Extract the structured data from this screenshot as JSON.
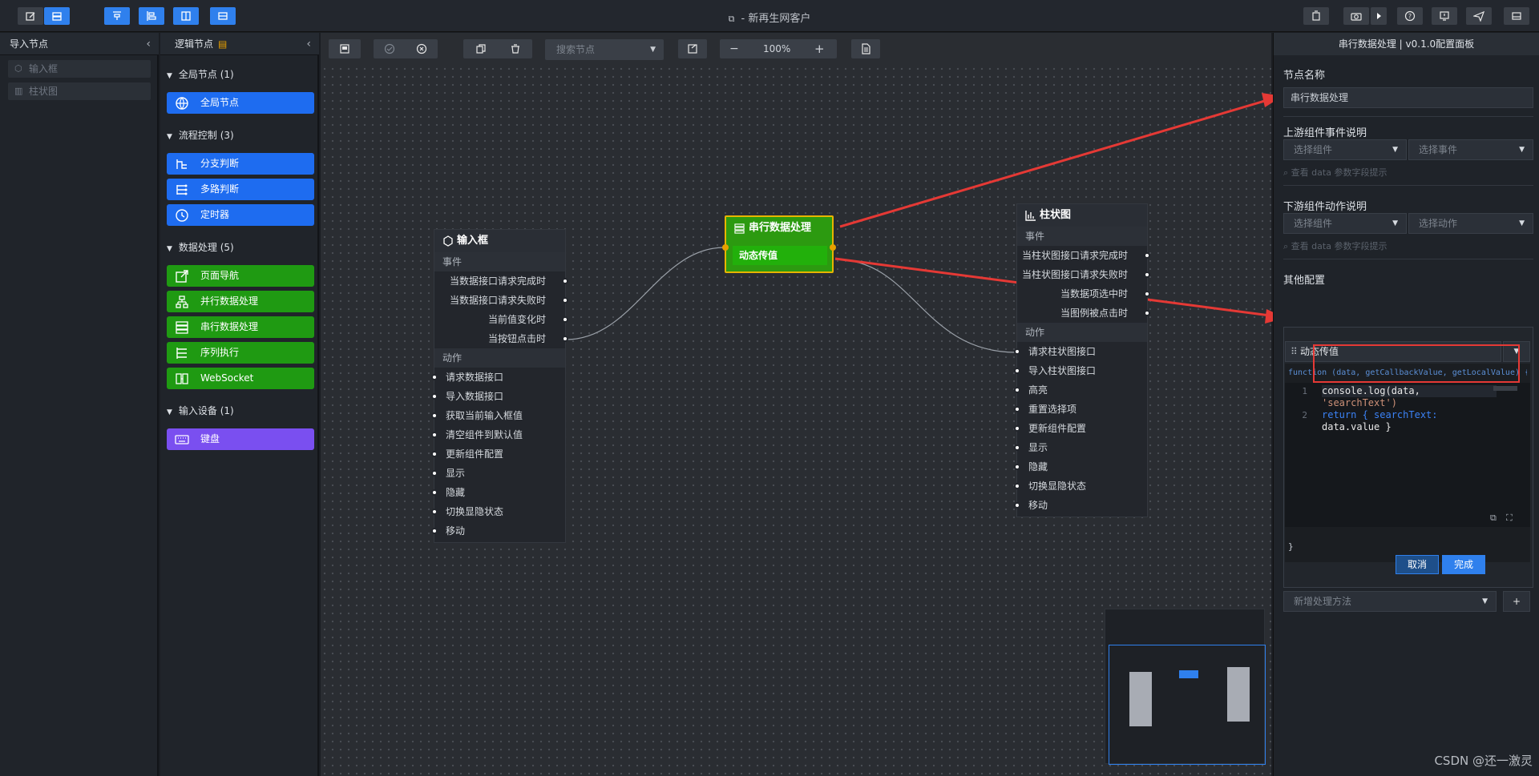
{
  "window": {
    "title": "- 新再生网客户"
  },
  "import_panel": {
    "title": "导入节点",
    "items": [
      {
        "label": "输入框",
        "icon": "input-icon"
      },
      {
        "label": "柱状图",
        "icon": "bar-chart-icon"
      }
    ]
  },
  "logic_panel": {
    "title": "逻辑节点",
    "groups": [
      {
        "title": "全局节点 (1)",
        "items": [
          {
            "label": "全局节点",
            "icon": "globe-icon",
            "color": "#1e6cf0"
          }
        ]
      },
      {
        "title": "流程控制 (3)",
        "items": [
          {
            "label": "分支判断",
            "icon": "branch-icon",
            "color": "#1e6cf0"
          },
          {
            "label": "多路判断",
            "icon": "multi-branch-icon",
            "color": "#1e6cf0"
          },
          {
            "label": "定时器",
            "icon": "clock-icon",
            "color": "#1e6cf0"
          }
        ]
      },
      {
        "title": "数据处理 (5)",
        "items": [
          {
            "label": "页面导航",
            "icon": "external-link-icon",
            "color": "#1f9a12"
          },
          {
            "label": "并行数据处理",
            "icon": "parallel-icon",
            "color": "#1f9a12"
          },
          {
            "label": "串行数据处理",
            "icon": "serial-icon",
            "color": "#1f9a12"
          },
          {
            "label": "序列执行",
            "icon": "sequence-icon",
            "color": "#1f9a12"
          },
          {
            "label": "WebSocket",
            "icon": "websocket-icon",
            "color": "#1f9a12"
          }
        ]
      },
      {
        "title": "输入设备 (1)",
        "items": [
          {
            "label": "键盘",
            "icon": "keyboard-icon",
            "color": "#7a4ff0"
          }
        ]
      }
    ]
  },
  "canvas_toolbar": {
    "search_placeholder": "搜索节点",
    "zoom": "100%"
  },
  "nodes": {
    "input": {
      "title": "输入框",
      "events_label": "事件",
      "events": [
        "当数据接口请求完成时",
        "当数据接口请求失败时",
        "当前值变化时",
        "当按钮点击时"
      ],
      "actions_label": "动作",
      "actions": [
        "请求数据接口",
        "导入数据接口",
        "获取当前输入框值",
        "清空组件到默认值",
        "更新组件配置",
        "显示",
        "隐藏",
        "切换显隐状态",
        "移动"
      ]
    },
    "serial": {
      "title": "串行数据处理",
      "sub": "动态传值"
    },
    "bar": {
      "title": "柱状图",
      "events_label": "事件",
      "events": [
        "当柱状图接口请求完成时",
        "当柱状图接口请求失败时",
        "当数据项选中时",
        "当图例被点击时"
      ],
      "actions_label": "动作",
      "actions": [
        "请求柱状图接口",
        "导入柱状图接口",
        "高亮",
        "重置选择项",
        "更新组件配置",
        "显示",
        "隐藏",
        "切换显隐状态",
        "移动"
      ]
    }
  },
  "config_panel": {
    "title": "串行数据处理 | v0.1.0配置面板",
    "node_name_label": "节点名称",
    "node_name_value": "串行数据处理",
    "upstream_label": "上游组件事件说明",
    "upstream_component_placeholder": "选择组件",
    "upstream_event_placeholder": "选择事件",
    "upstream_hint": "查看 data 参数字段提示",
    "downstream_label": "下游组件动作说明",
    "downstream_component_placeholder": "选择组件",
    "downstream_action_placeholder": "选择动作",
    "downstream_hint": "查看 data 参数字段提示",
    "other_label": "其他配置",
    "method_title": "动态传值",
    "function_signature": "function (data, getCallbackValue, getLocalValue) {",
    "code_line1_a": "console.log(data,",
    "code_line1_b": "'searchText')",
    "code_line2_a": "return { searchText:",
    "code_line2_b": "data.value }",
    "line_numbers": [
      "1",
      "2"
    ],
    "closing_brace": "}",
    "cancel_label": "取消",
    "done_label": "完成",
    "add_method_placeholder": "新增处理方法",
    "add_button_label": "+"
  },
  "watermark": "CSDN @还一激灵",
  "colors": {
    "accent_blue": "#2f80ed",
    "node_green": "#2c9a10",
    "highlight_red": "#e53935",
    "border_yellow": "#e8b400"
  }
}
